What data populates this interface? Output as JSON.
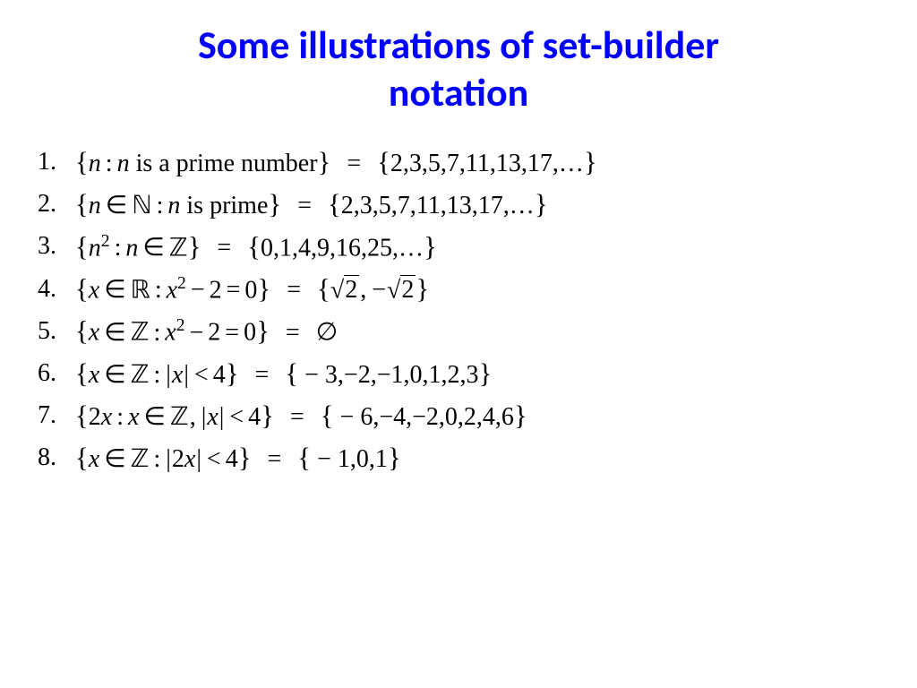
{
  "title_line1": "Some illustrations of set-builder",
  "title_line2": "notation",
  "items": [
    {
      "num": "1.",
      "text": "{n : n is a prime number} = {2,3,5,7,11,13,17,…}"
    },
    {
      "num": "2.",
      "text": "{n ∈ ℕ : n is prime} = {2,3,5,7,11,13,17,…}"
    },
    {
      "num": "3.",
      "text": "{n² : n ∈ ℤ} = {0,1,4,9,16,25,…}"
    },
    {
      "num": "4.",
      "text": "{x ∈ ℝ : x² − 2 = 0} = {√2, −√2}"
    },
    {
      "num": "5.",
      "text": "{x ∈ ℤ : x² − 2 = 0} = ∅"
    },
    {
      "num": "6.",
      "text": "{x ∈ ℤ : |x| < 4} = {−3,−2,−1,0,1,2,3}"
    },
    {
      "num": "7.",
      "text": "{2x : x ∈ ℤ, |x| < 4} = {−6,−4,−2,0,2,4,6}"
    },
    {
      "num": "8.",
      "text": "{x ∈ ℤ : |2x| < 4} = {−1,0,1}"
    }
  ],
  "rhs": {
    "r1": "2,3,5,7,11,13,17,…",
    "r2": "2,3,5,7,11,13,17,…",
    "r3": "0,1,4,9,16,25,…",
    "r6": " − 3,−2,−1,0,1,2,3",
    "r7": " − 6,−4,−2,0,2,4,6",
    "r8": " − 1,0,1"
  },
  "words": {
    "is_a_prime_number": " is a prime number",
    "is_prime": " is prime"
  },
  "sym": {
    "N": "ℕ",
    "Z": "ℤ",
    "R": "ℝ",
    "empty": "∅",
    "in": "∈",
    "lt": "<",
    "minus": "−",
    "two": "2",
    "four": "4",
    "zero": "0",
    "sqrt2": "2"
  }
}
